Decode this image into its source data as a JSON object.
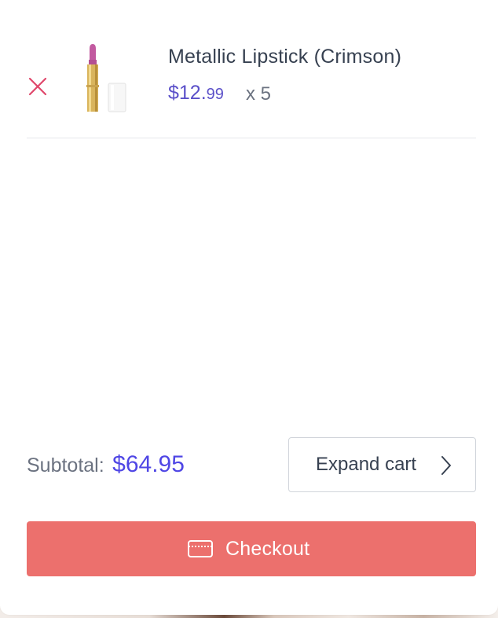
{
  "cart": {
    "items": [
      {
        "name": "Metallic Lipstick (Crimson)",
        "price_main": "$12.",
        "price_cents": "99",
        "quantity": "x 5",
        "image": "lipstick-image",
        "remove_icon": "close-icon"
      }
    ]
  },
  "summary": {
    "subtotal_label": "Subtotal:",
    "subtotal_value": "$64.95"
  },
  "actions": {
    "expand_label": "Expand cart",
    "expand_icon": "chevron-right-icon",
    "checkout_label": "Checkout",
    "checkout_icon": "credit-card-icon"
  },
  "colors": {
    "accent": "#4f46e5",
    "checkout_bg": "#ec706d",
    "remove": "#e0476b"
  }
}
